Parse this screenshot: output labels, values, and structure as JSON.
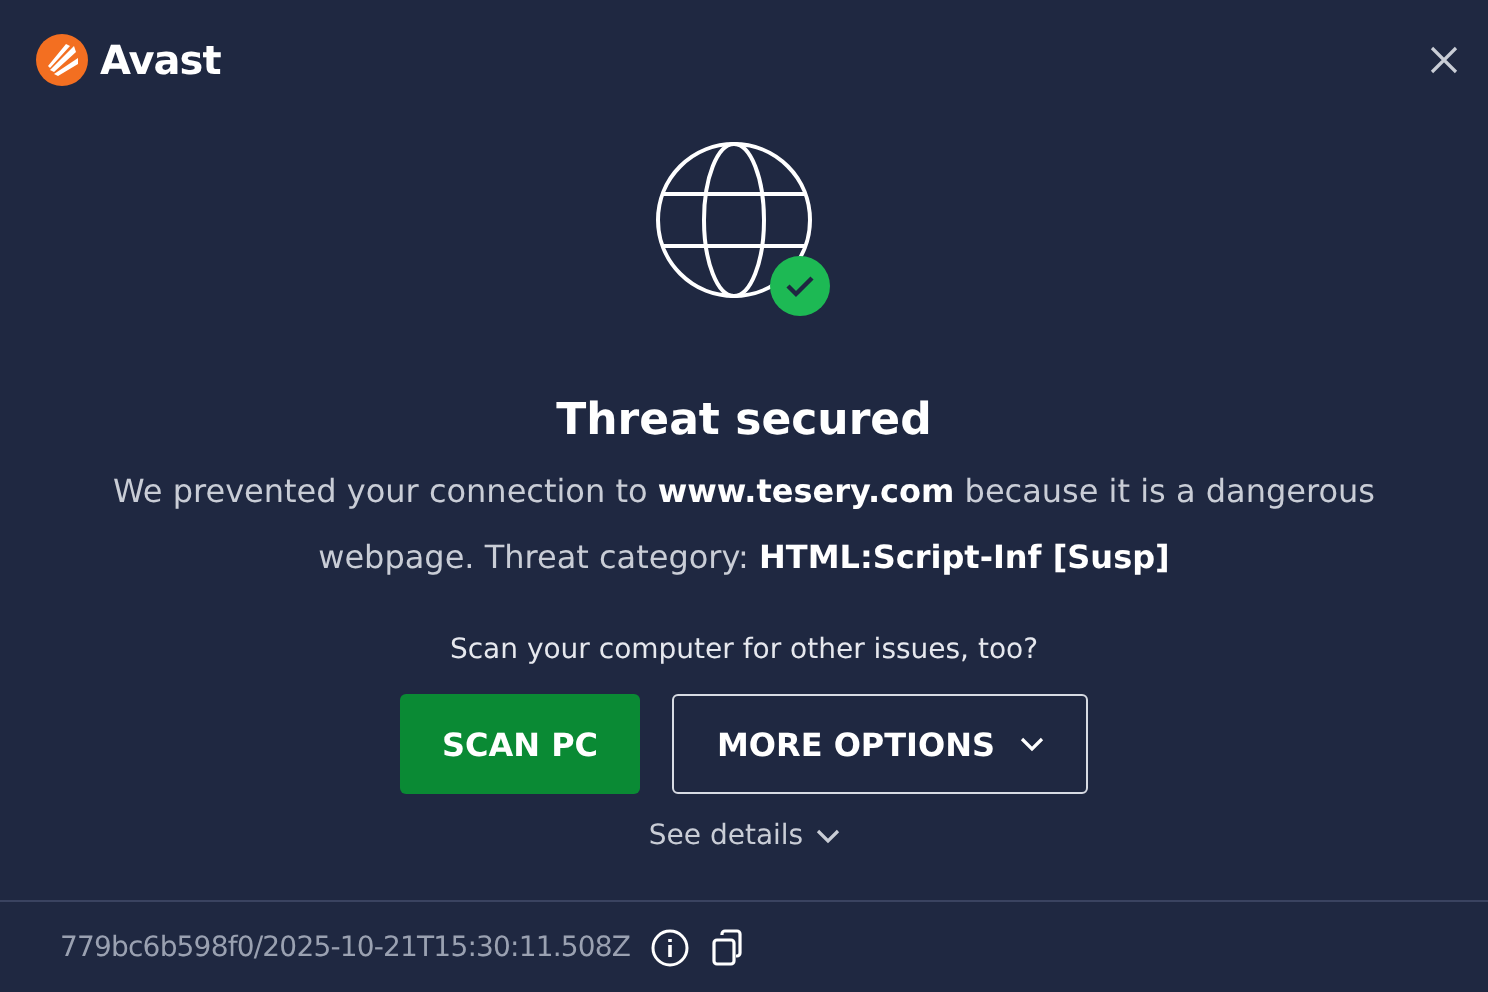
{
  "brand": "Avast",
  "title": "Threat secured",
  "message": "We prevented your connection to **www.tesery.com** because it is a dangerous webpage. Threat category: **HTML:Script-Inf [Susp]**",
  "prompt": "Scan your computer for other issues, too?",
  "buttons": [
    {
      "kind": "primary",
      "label": "SCAN PC"
    },
    {
      "kind": "dropdown",
      "label": "MORE OPTIONS"
    }
  ],
  "details_link": "See details",
  "footer": {
    "id": "779bc6b598f0/2025-10-21T15:30:11.508Z"
  }
}
